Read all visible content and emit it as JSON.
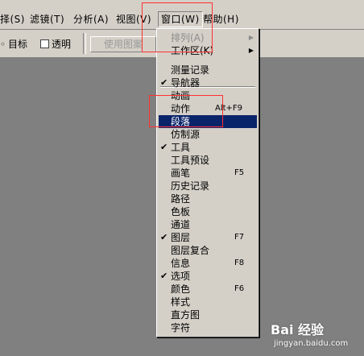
{
  "menubar": {
    "items": [
      {
        "label": "择(S)"
      },
      {
        "label": "滤镜(T)"
      },
      {
        "label": "分析(A)"
      },
      {
        "label": "视图(V)"
      },
      {
        "label": "窗口(W)"
      },
      {
        "label": "帮助(H)"
      }
    ]
  },
  "toolbar": {
    "target_label": "目标",
    "transparent_label": "透明",
    "pattern_button": "使用图案"
  },
  "window_menu": {
    "items": [
      {
        "label": "排列(A)"
      },
      {
        "label": "工作区(K)"
      },
      {
        "label": "测量记录"
      },
      {
        "label": "导航器"
      },
      {
        "label": "动画"
      },
      {
        "label": "动作",
        "shortcut": "Alt+F9"
      },
      {
        "label": "段落"
      },
      {
        "label": "仿制源"
      },
      {
        "label": "工具"
      },
      {
        "label": "工具预设"
      },
      {
        "label": "画笔",
        "shortcut": "F5"
      },
      {
        "label": "历史记录"
      },
      {
        "label": "路径"
      },
      {
        "label": "色板"
      },
      {
        "label": "通道"
      },
      {
        "label": "图层",
        "shortcut": "F7"
      },
      {
        "label": "图层复合"
      },
      {
        "label": "信息",
        "shortcut": "F8"
      },
      {
        "label": "选项"
      },
      {
        "label": "颜色",
        "shortcut": "F6"
      },
      {
        "label": "样式"
      },
      {
        "label": "直方图"
      },
      {
        "label": "字符"
      }
    ]
  },
  "watermark": {
    "brand": "Bai 经验",
    "url": "jingyan.baidu.com"
  }
}
